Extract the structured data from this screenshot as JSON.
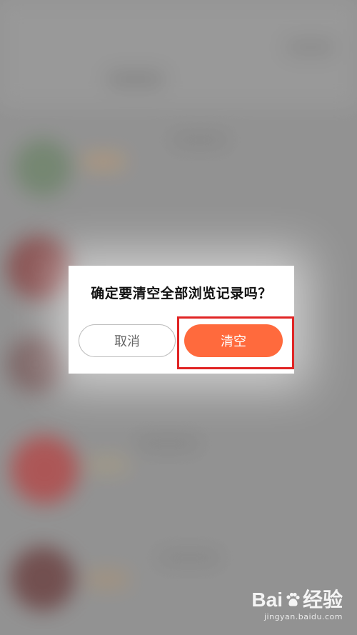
{
  "dialog": {
    "title": "确定要清空全部浏览记录吗？",
    "cancel_label": "取消",
    "confirm_label": "清空"
  },
  "colors": {
    "confirm_button": "#ff6a3d",
    "highlight_border": "#e02424",
    "overlay": "#9c9c9c"
  },
  "watermark": {
    "brand_left": "Bai",
    "brand_right": "经验",
    "url": "jingyan.baidu.com"
  }
}
